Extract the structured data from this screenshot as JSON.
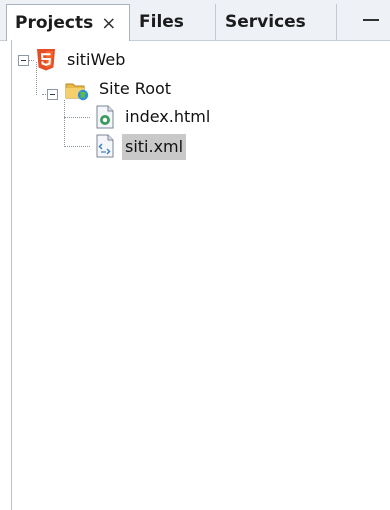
{
  "tabs": [
    {
      "label": "Projects",
      "active": true,
      "close_glyph": "×"
    },
    {
      "label": "Files",
      "active": false
    },
    {
      "label": "Services",
      "active": false
    }
  ],
  "tree": {
    "project": {
      "label": "sitiWeb",
      "icon": "html5-project-icon",
      "expanded": true
    },
    "site_root": {
      "label": "Site Root",
      "icon": "web-folder-icon",
      "expanded": true
    },
    "files": [
      {
        "label": "index.html",
        "icon": "html-file-icon",
        "selected": false
      },
      {
        "label": "siti.xml",
        "icon": "xml-file-icon",
        "selected": true
      }
    ]
  },
  "colors": {
    "html5_orange": "#e44d26",
    "folder_yellow": "#e8b84a",
    "selection_gray": "#c9c9c9"
  }
}
